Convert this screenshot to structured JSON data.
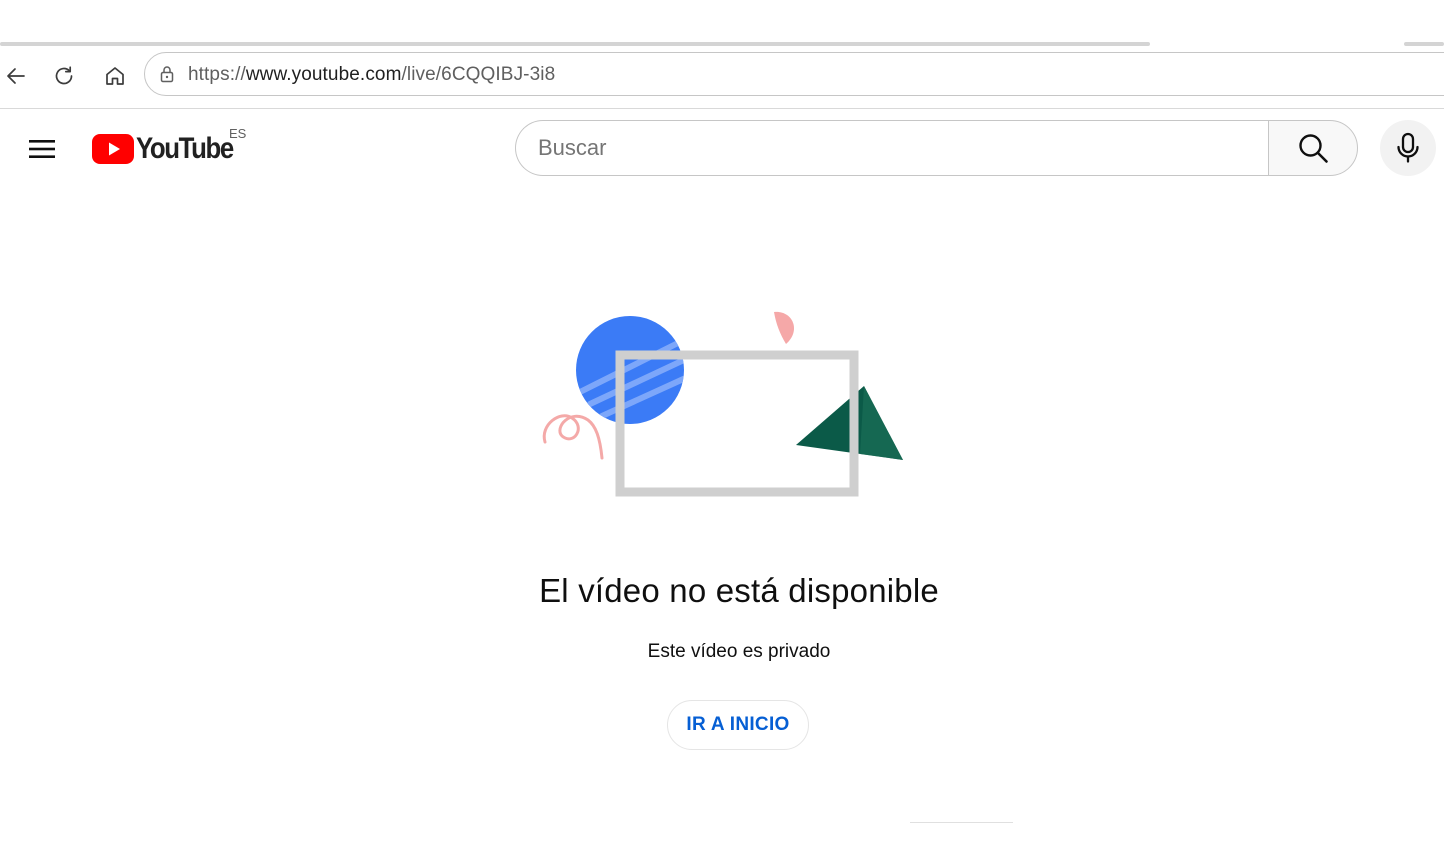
{
  "browser": {
    "url_scheme": "https://",
    "url_host": "www.youtube.com",
    "url_path": "/live/6CQQIBJ-3i8",
    "icons": {
      "back": "arrow-left-icon",
      "reload": "reload-icon",
      "home": "home-icon",
      "lock": "lock-icon"
    }
  },
  "masthead": {
    "logo_text": "YouTube",
    "country_code": "ES",
    "search_placeholder": "Buscar",
    "search_value": "",
    "icons": {
      "menu": "hamburger-menu-icon",
      "search": "search-icon",
      "mic": "microphone-icon"
    },
    "brand_color": "#ff0000"
  },
  "error": {
    "title": "El vídeo no está disponible",
    "subtitle": "Este vídeo es privado",
    "button_label": "IR A INICIO",
    "button_color": "#065fd4"
  }
}
